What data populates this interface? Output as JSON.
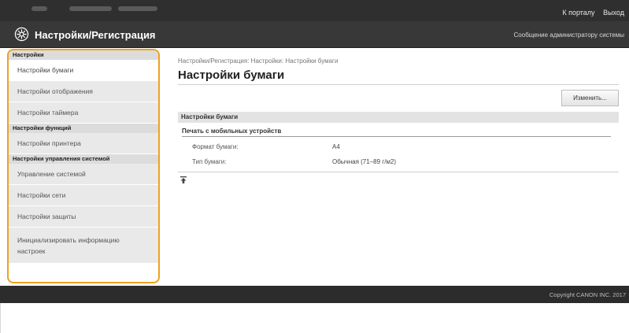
{
  "topbar": {
    "portal_link": "К порталу",
    "logout_link": "Выход"
  },
  "header": {
    "title": "Настройки/Регистрация",
    "admin_message": "Сообщение администратору системы",
    "icon": "gear-icon"
  },
  "sidebar": {
    "section1": "Настройки",
    "items1": [
      "Настройки бумаги",
      "Настройки отображения",
      "Настройки таймера"
    ],
    "section2": "Настройки функций",
    "items2": [
      "Настройки принтера"
    ],
    "section3": "Настройки управления системой",
    "items3": [
      "Управление системой",
      "Настройки сети",
      "Настройки защиты"
    ],
    "reset_item_line1": "Инициализировать информацию",
    "reset_item_line2": "настроек",
    "highlight_color": "#f0a020"
  },
  "main": {
    "breadcrumb": "Настройки/Регистрация: Настройки: Настройки бумаги",
    "title": "Настройки бумаги",
    "edit_button": "Изменить...",
    "section_title": "Настройки бумаги",
    "subsection_title": "Печать с мобильных устройств",
    "rows": [
      {
        "label": "Формат бумаги:",
        "value": "A4"
      },
      {
        "label": "Тип бумаги:",
        "value": "Обычная (71–89 г/м2)"
      }
    ],
    "top_icon": "arrow-to-top-icon"
  },
  "footer": {
    "copyright": "Copyright CANON INC. 2017"
  }
}
